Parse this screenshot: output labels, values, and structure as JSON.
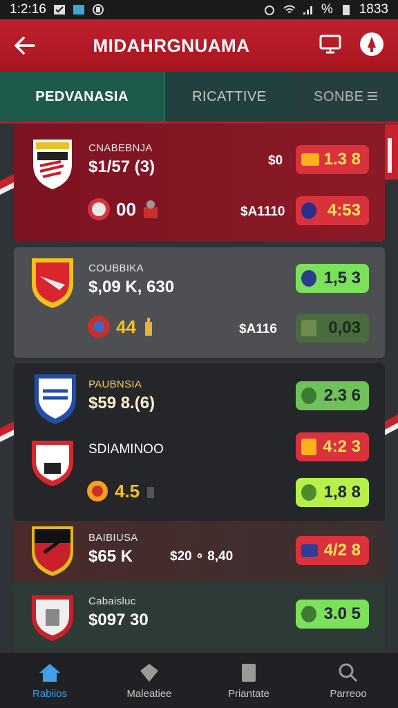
{
  "status": {
    "time": "1:2:16",
    "right_time": "1833",
    "battery_pct": "%"
  },
  "appbar": {
    "title": "MIDAHRGNUAMA"
  },
  "tabs": [
    {
      "label": "PEDVANASIA"
    },
    {
      "label": "RICATTIVE"
    },
    {
      "label": "SONBE"
    }
  ],
  "cards": [
    {
      "name": "CNABEBNJA",
      "price": "$1/57 (3)",
      "right_label": "$0",
      "pill_top": "1.3 8",
      "stat_val": "00",
      "mid_price": "$A1110",
      "pill_bottom": "4:53"
    },
    {
      "name": "COUBBIKA",
      "price": "$,09 K, 630",
      "pill_top": "1,5 3",
      "stat_val": "44",
      "mid_price": "$A116",
      "pill_bottom": "0,03"
    },
    {
      "name": "PAUBNSIA",
      "price": "$59 8.(6)",
      "pill_top": "2.3 6",
      "name2": "SDIAMINOO",
      "pill_mid": "4:2 3",
      "stat_val": "4.5",
      "pill_bottom": "1,8 8"
    },
    {
      "name": "BAIBIUSA",
      "price": "$65 K",
      "mid_price": "$20 ∘ 8,40",
      "pill_top": "4/2 8"
    },
    {
      "name": "Cabaisluc",
      "price": "$097 30",
      "pill_top": "3.0 5"
    }
  ],
  "nav": [
    {
      "label": "Rabiios"
    },
    {
      "label": "Maleatiee"
    },
    {
      "label": "Priantate"
    },
    {
      "label": "Parreoo"
    }
  ],
  "colors": {
    "brand_red": "#b51c28",
    "teal_tab": "#1e5a4c",
    "pill_green": "#7be05a",
    "pill_red": "#d8323c",
    "nav_active": "#3ea0e6"
  }
}
